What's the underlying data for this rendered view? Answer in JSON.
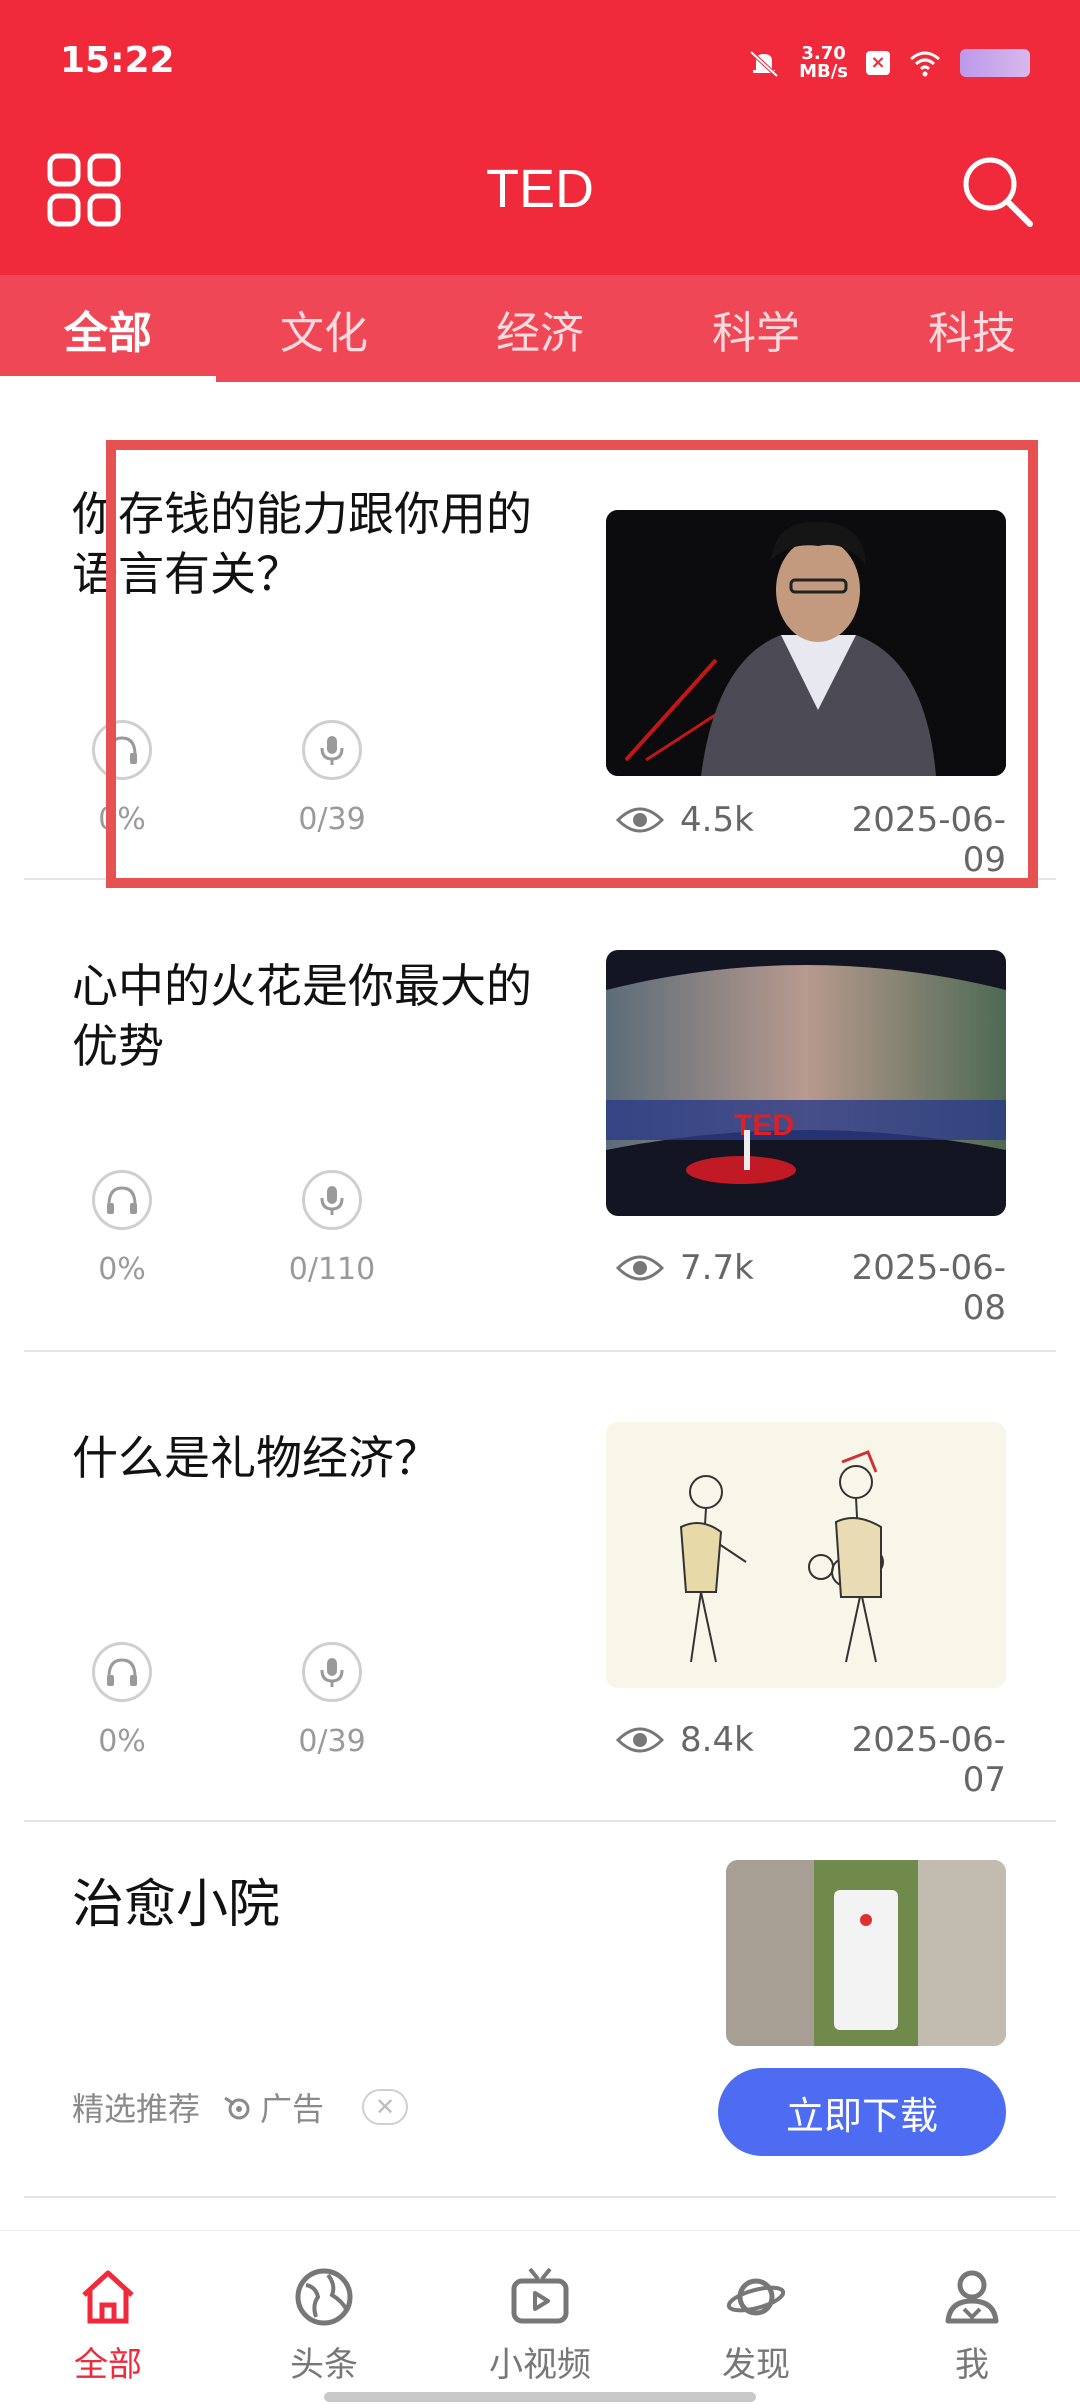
{
  "status": {
    "time": "15:22",
    "speed_top": "3.70",
    "speed_unit": "MB/s"
  },
  "header": {
    "title": "TED"
  },
  "tabs": [
    {
      "label": "全部",
      "active": true
    },
    {
      "label": "文化",
      "active": false
    },
    {
      "label": "经济",
      "active": false
    },
    {
      "label": "科学",
      "active": false
    },
    {
      "label": "科技",
      "active": false
    }
  ],
  "feed": [
    {
      "title": "你存钱的能力跟你用的语言有关？",
      "listen_progress": "0%",
      "speak_progress": "0/39",
      "views": "4.5k",
      "date": "2025-06-09"
    },
    {
      "title": "心中的火花是你最大的优势",
      "listen_progress": "0%",
      "speak_progress": "0/110",
      "views": "7.7k",
      "date": "2025-06-08"
    },
    {
      "title": "什么是礼物经济？",
      "listen_progress": "0%",
      "speak_progress": "0/39",
      "views": "8.4k",
      "date": "2025-06-07"
    }
  ],
  "ad": {
    "title": "治愈小院",
    "subtitle": "精选推荐",
    "ad_label": "广告",
    "button": "立即下载"
  },
  "bottom_nav": [
    {
      "label": "全部",
      "icon": "home-icon",
      "active": true
    },
    {
      "label": "头条",
      "icon": "globe-icon",
      "active": false
    },
    {
      "label": "小视频",
      "icon": "tv-play-icon",
      "active": false
    },
    {
      "label": "发现",
      "icon": "planet-icon",
      "active": false
    },
    {
      "label": "我",
      "icon": "user-icon",
      "active": false
    }
  ],
  "colors": {
    "brand_red": "#f0293b",
    "tab_red": "#f04757",
    "download_blue": "#4d6cf1",
    "highlight": "#e85152"
  }
}
